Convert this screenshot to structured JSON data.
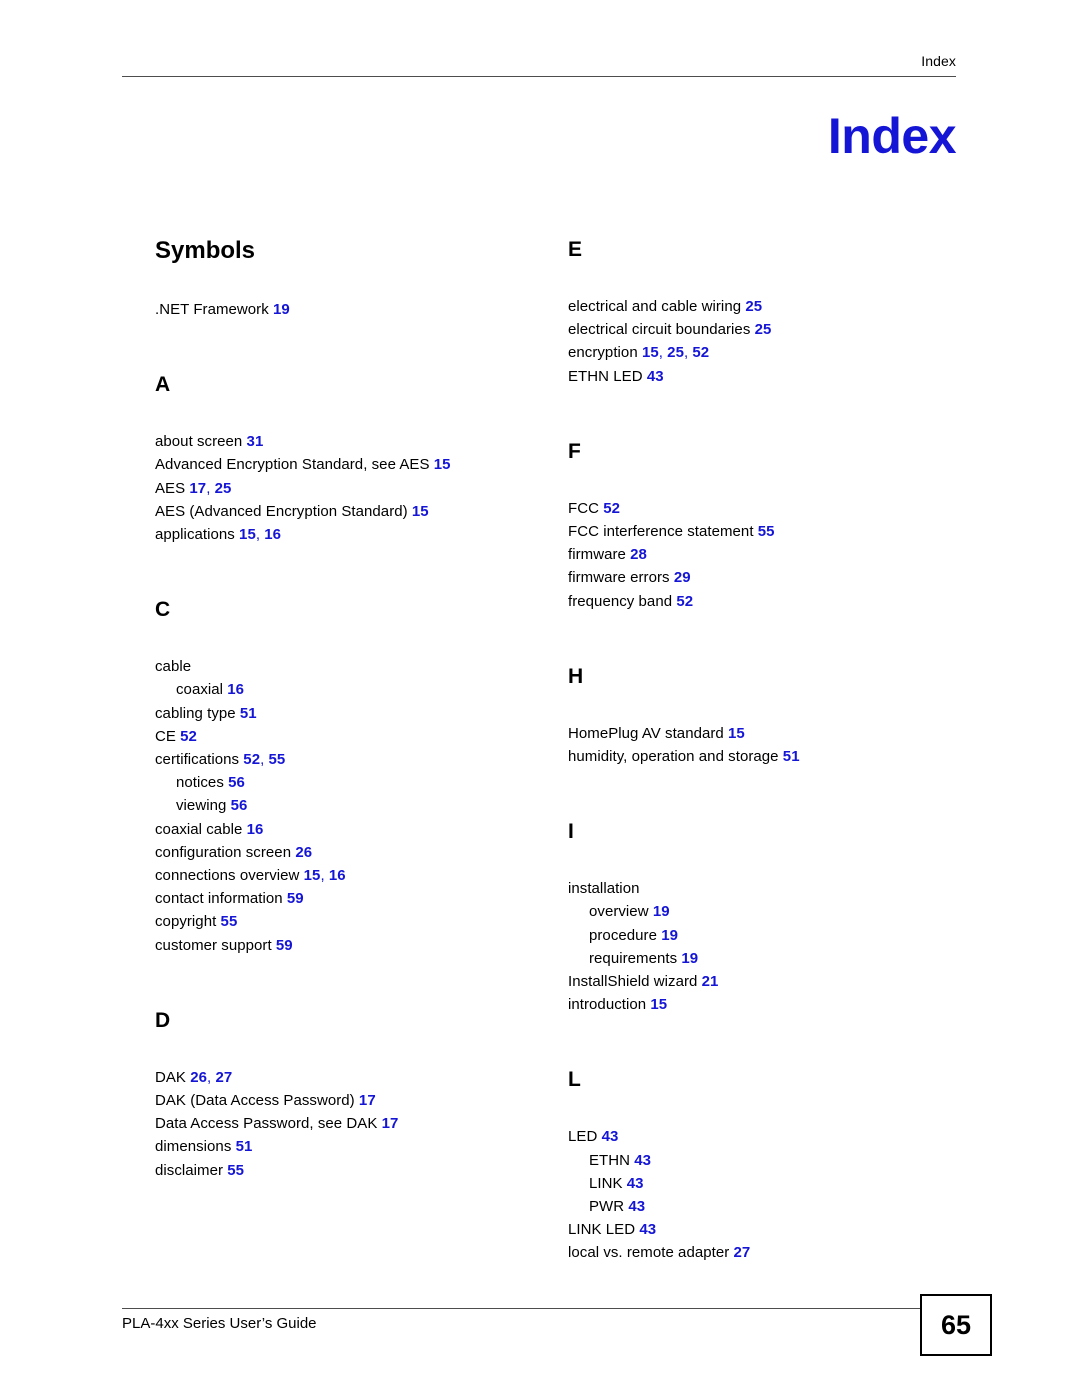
{
  "header": {
    "running_head": "Index"
  },
  "title": "Index",
  "footer": {
    "guide_name": "PLA-4xx Series User’s Guide",
    "page_number": "65"
  },
  "colors": {
    "page_number_link": "#1515d6",
    "title": "#1515d6",
    "text": "#000000",
    "rule": "#4d4d4d"
  },
  "index": {
    "columns": [
      {
        "id": "left",
        "groups": [
          {
            "heading": "Symbols",
            "heading_style": "word",
            "entries": [
              {
                "text": ".NET Framework",
                "sub": false,
                "pages": [
                  "19"
                ]
              }
            ]
          },
          {
            "heading": "A",
            "heading_style": "letter",
            "entries": [
              {
                "text": "about screen",
                "sub": false,
                "pages": [
                  "31"
                ]
              },
              {
                "text": "Advanced Encryption Standard, see AES",
                "sub": false,
                "pages": [
                  "15"
                ]
              },
              {
                "text": "AES",
                "sub": false,
                "pages": [
                  "17",
                  "25"
                ]
              },
              {
                "text": "AES (Advanced Encryption Standard)",
                "sub": false,
                "pages": [
                  "15"
                ]
              },
              {
                "text": "applications",
                "sub": false,
                "pages": [
                  "15",
                  "16"
                ]
              }
            ]
          },
          {
            "heading": "C",
            "heading_style": "letter",
            "entries": [
              {
                "text": "cable",
                "sub": false,
                "pages": []
              },
              {
                "text": "coaxial",
                "sub": true,
                "pages": [
                  "16"
                ]
              },
              {
                "text": "cabling type",
                "sub": false,
                "pages": [
                  "51"
                ]
              },
              {
                "text": "CE",
                "sub": false,
                "pages": [
                  "52"
                ]
              },
              {
                "text": "certifications",
                "sub": false,
                "pages": [
                  "52",
                  "55"
                ]
              },
              {
                "text": "notices",
                "sub": true,
                "pages": [
                  "56"
                ]
              },
              {
                "text": "viewing",
                "sub": true,
                "pages": [
                  "56"
                ]
              },
              {
                "text": "coaxial cable",
                "sub": false,
                "pages": [
                  "16"
                ]
              },
              {
                "text": "configuration screen",
                "sub": false,
                "pages": [
                  "26"
                ]
              },
              {
                "text": "connections overview",
                "sub": false,
                "pages": [
                  "15",
                  "16"
                ]
              },
              {
                "text": "contact information",
                "sub": false,
                "pages": [
                  "59"
                ]
              },
              {
                "text": "copyright",
                "sub": false,
                "pages": [
                  "55"
                ]
              },
              {
                "text": "customer support",
                "sub": false,
                "pages": [
                  "59"
                ]
              }
            ]
          },
          {
            "heading": "D",
            "heading_style": "letter",
            "entries": [
              {
                "text": "DAK",
                "sub": false,
                "pages": [
                  "26",
                  "27"
                ]
              },
              {
                "text": "DAK (Data Access Password)",
                "sub": false,
                "pages": [
                  "17"
                ]
              },
              {
                "text": "Data Access Password, see DAK",
                "sub": false,
                "pages": [
                  "17"
                ]
              },
              {
                "text": "dimensions",
                "sub": false,
                "pages": [
                  "51"
                ]
              },
              {
                "text": "disclaimer",
                "sub": false,
                "pages": [
                  "55"
                ]
              }
            ]
          }
        ]
      },
      {
        "id": "right",
        "groups": [
          {
            "heading": "E",
            "heading_style": "letter",
            "entries": [
              {
                "text": "electrical and cable wiring",
                "sub": false,
                "pages": [
                  "25"
                ]
              },
              {
                "text": "electrical circuit boundaries",
                "sub": false,
                "pages": [
                  "25"
                ]
              },
              {
                "text": "encryption",
                "sub": false,
                "pages": [
                  "15",
                  "25",
                  "52"
                ]
              },
              {
                "text": "ETHN LED",
                "sub": false,
                "pages": [
                  "43"
                ]
              }
            ]
          },
          {
            "heading": "F",
            "heading_style": "letter",
            "entries": [
              {
                "text": "FCC",
                "sub": false,
                "pages": [
                  "52"
                ]
              },
              {
                "text": "FCC interference statement",
                "sub": false,
                "pages": [
                  "55"
                ]
              },
              {
                "text": "firmware",
                "sub": false,
                "pages": [
                  "28"
                ]
              },
              {
                "text": "firmware errors",
                "sub": false,
                "pages": [
                  "29"
                ]
              },
              {
                "text": "frequency band",
                "sub": false,
                "pages": [
                  "52"
                ]
              }
            ]
          },
          {
            "heading": "H",
            "heading_style": "letter",
            "entries": [
              {
                "text": "HomePlug AV standard",
                "sub": false,
                "pages": [
                  "15"
                ]
              },
              {
                "text": "humidity, operation and storage",
                "sub": false,
                "pages": [
                  "51"
                ]
              }
            ]
          },
          {
            "heading": "I",
            "heading_style": "letter",
            "entries": [
              {
                "text": "installation",
                "sub": false,
                "pages": []
              },
              {
                "text": "overview",
                "sub": true,
                "pages": [
                  "19"
                ]
              },
              {
                "text": "procedure",
                "sub": true,
                "pages": [
                  "19"
                ]
              },
              {
                "text": "requirements",
                "sub": true,
                "pages": [
                  "19"
                ]
              },
              {
                "text": "InstallShield wizard",
                "sub": false,
                "pages": [
                  "21"
                ]
              },
              {
                "text": "introduction",
                "sub": false,
                "pages": [
                  "15"
                ]
              }
            ]
          },
          {
            "heading": "L",
            "heading_style": "letter",
            "entries": [
              {
                "text": "LED",
                "sub": false,
                "pages": [
                  "43"
                ]
              },
              {
                "text": "ETHN",
                "sub": true,
                "pages": [
                  "43"
                ]
              },
              {
                "text": "LINK",
                "sub": true,
                "pages": [
                  "43"
                ]
              },
              {
                "text": "PWR",
                "sub": true,
                "pages": [
                  "43"
                ]
              },
              {
                "text": "LINK LED",
                "sub": false,
                "pages": [
                  "43"
                ]
              },
              {
                "text": "local vs. remote adapter",
                "sub": false,
                "pages": [
                  "27"
                ]
              }
            ]
          }
        ]
      }
    ]
  }
}
